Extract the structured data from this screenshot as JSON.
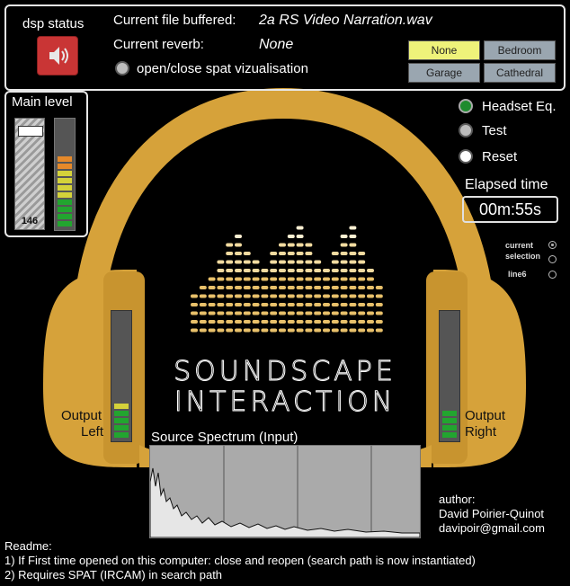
{
  "header": {
    "dsp_status_label": "dsp status",
    "file_label": "Current file buffered:",
    "file_value": "2a RS Video Narration.wav",
    "reverb_label": "Current reverb:",
    "reverb_value": "None",
    "spat_toggle_label": "open/close spat vizualisation"
  },
  "reverb_options": [
    {
      "label": "None",
      "selected": true
    },
    {
      "label": "Bedroom",
      "selected": false
    },
    {
      "label": "Garage",
      "selected": false
    },
    {
      "label": "Cathedral",
      "selected": false
    }
  ],
  "main_level": {
    "label": "Main level",
    "value": "146"
  },
  "controls": {
    "headset_eq": "Headset Eq.",
    "test": "Test",
    "reset": "Reset"
  },
  "elapsed": {
    "label": "Elapsed time",
    "value": "00m:55s"
  },
  "selection": {
    "current_selection_line1": "current",
    "current_selection_line2": "selection",
    "line6": "line6"
  },
  "logo": {
    "line1": "SOUNDSCAPE",
    "line2": "INTERACTION"
  },
  "outputs": {
    "left_line1": "Output",
    "left_line2": "Left",
    "right_line1": "Output",
    "right_line2": "Right"
  },
  "spectrum": {
    "title": "Source Spectrum (Input)"
  },
  "author": {
    "label": "author:",
    "name": "David Poirier-Quinot",
    "email": "davipoir@gmail.com"
  },
  "readme": {
    "title": "Readme:",
    "line1": "1) If First time opened on this computer: close and reopen (search path is now instantiated)",
    "line2": "2) Requires SPAT (IRCAM) in search path"
  },
  "colors": {
    "headphone_gold": "#d6a23a",
    "button_selected": "#eef27a",
    "button_default": "#9aa6b0",
    "meter_green": "#22a52f",
    "meter_yellow": "#d4d23a",
    "meter_orange": "#e5892a"
  }
}
